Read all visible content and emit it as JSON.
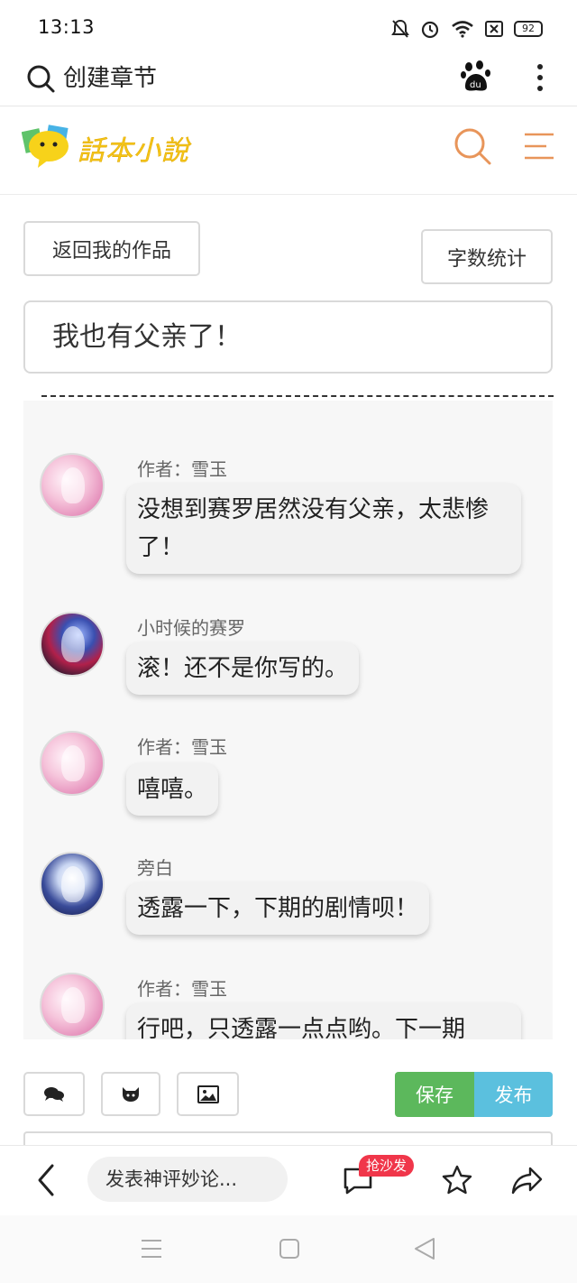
{
  "status_bar": {
    "time": "13:13",
    "battery": "92"
  },
  "browser": {
    "query": "创建章节"
  },
  "site": {
    "logo_text": "話本小說",
    "accent_color": "#e8955a"
  },
  "editor": {
    "back_button": "返回我的作品",
    "count_button": "字数统计",
    "chapter_title": "我也有父亲了！",
    "save_button": "保存",
    "publish_button": "发布"
  },
  "messages": [
    {
      "sender": "作者：雪玉",
      "text": "没想到赛罗居然没有父亲，太悲惨了！",
      "avatar": "pink-avatar"
    },
    {
      "sender": "小时候的赛罗",
      "text": "滚！还不是你写的。",
      "avatar": "dark-avatar"
    },
    {
      "sender": "作者：雪玉",
      "text": "嘻嘻。",
      "avatar": "pink-avatar"
    },
    {
      "sender": "旁白",
      "text": "透露一下，下期的剧情呗！",
      "avatar": "blue-avatar"
    },
    {
      "sender": "作者：雪玉",
      "text": "行吧，只透露一点点哟。下一期",
      "avatar": "pink-avatar"
    }
  ],
  "bottom_bar": {
    "comment_placeholder": "发表神评妙论...",
    "sofa_badge": "抢沙发"
  },
  "colors": {
    "save": "#5cb85c",
    "publish": "#5bc0de",
    "badge": "#f0364a"
  }
}
